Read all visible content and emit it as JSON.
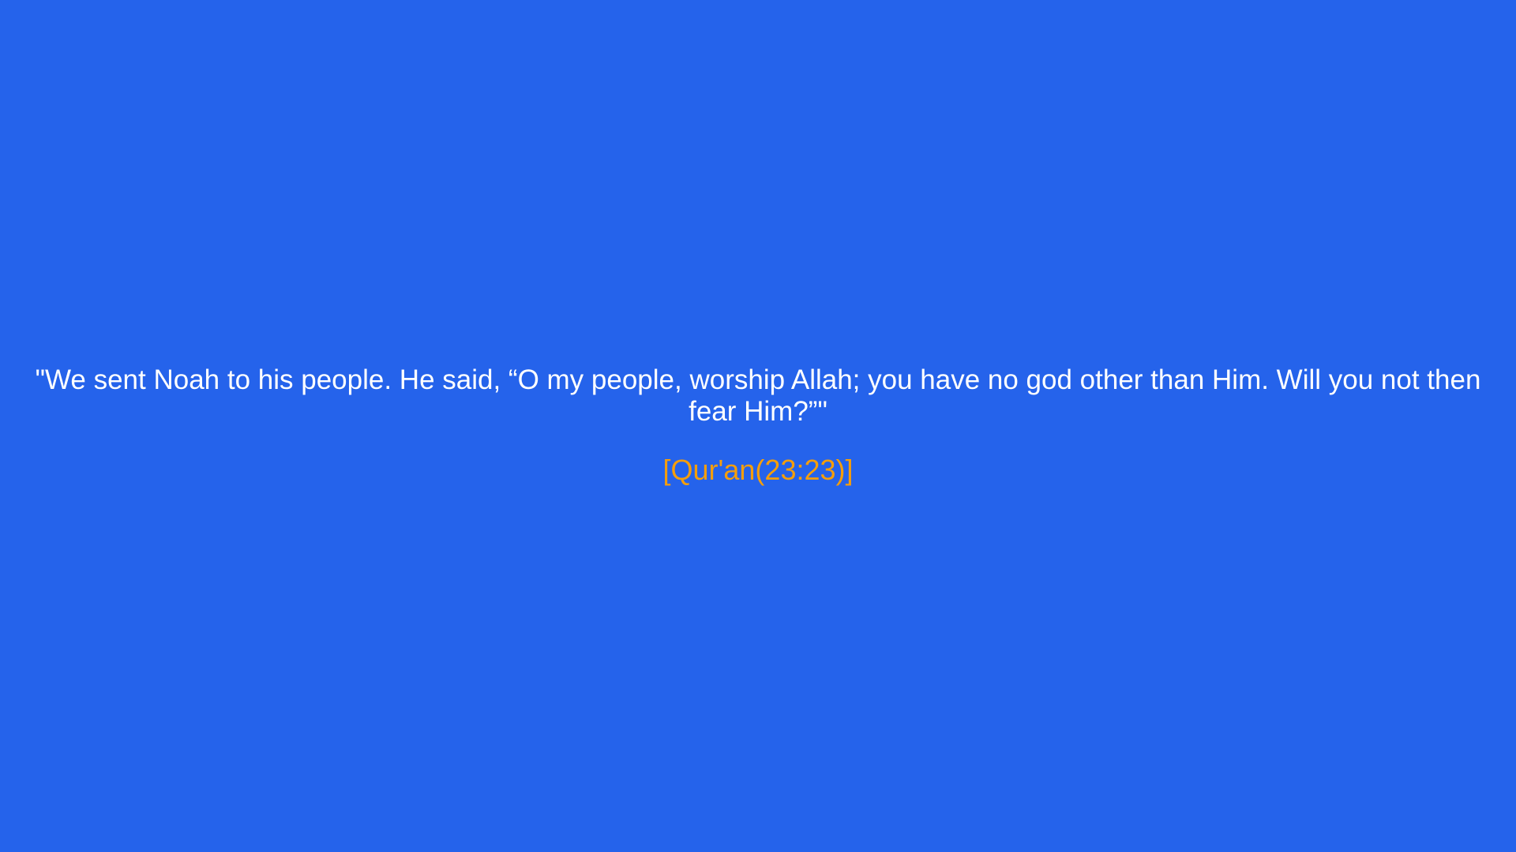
{
  "quote": {
    "text": "\"We sent Noah to his people. He said, “O my people, worship Allah; you have no god other than Him. Will you not then fear Him?”\"",
    "reference": "[Qur'an(23:23)]"
  },
  "colors": {
    "background": "#2563eb",
    "quote_text": "#ffffff",
    "reference_text": "#f59e0b"
  }
}
